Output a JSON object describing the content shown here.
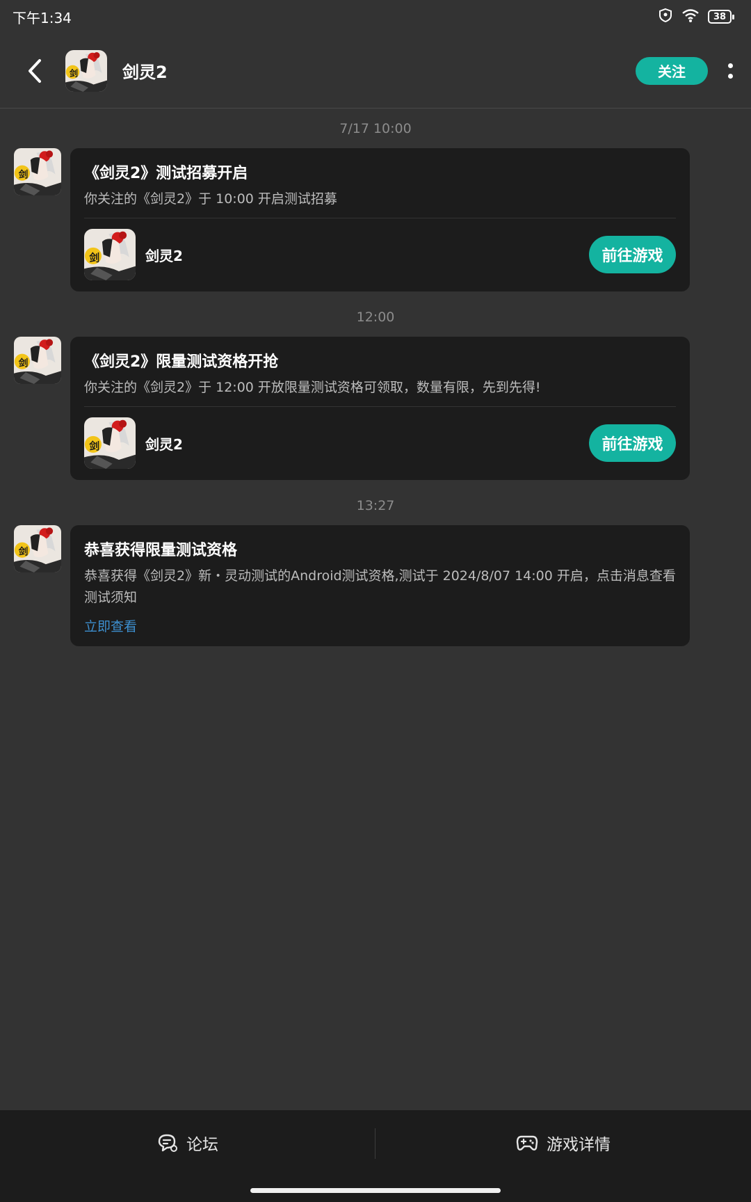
{
  "status_bar": {
    "time": "下午1:34",
    "battery": "38"
  },
  "header": {
    "title": "剑灵2",
    "follow_label": "关注"
  },
  "messages": [
    {
      "timestamp": "7/17   10:00",
      "title": "《剑灵2》测试招募开启",
      "body": "你关注的《剑灵2》于 10:00 开启测试招募",
      "game_name": "剑灵2",
      "button_label": "前往游戏"
    },
    {
      "timestamp": "12:00",
      "title": "《剑灵2》限量测试资格开抢",
      "body": "你关注的《剑灵2》于 12:00 开放限量测试资格可领取，数量有限，先到先得!",
      "game_name": "剑灵2",
      "button_label": "前往游戏"
    },
    {
      "timestamp": "13:27",
      "title": "恭喜获得限量测试资格",
      "body": "恭喜获得《剑灵2》新・灵动测试的Android测试资格,测试于 2024/8/07 14:00 开启，点击消息查看测试须知",
      "link_label": "立即查看"
    }
  ],
  "bottom_nav": {
    "forum_label": "论坛",
    "game_details_label": "游戏详情"
  },
  "colors": {
    "accent": "#14b3a0",
    "link": "#3d8fcf",
    "background": "#333333",
    "card": "#1c1c1c"
  },
  "icons": [
    "back-arrow-icon",
    "more-vertical-icon",
    "shield-icon",
    "wifi-icon",
    "battery-icon",
    "chat-bubble-icon",
    "gamepad-icon"
  ]
}
